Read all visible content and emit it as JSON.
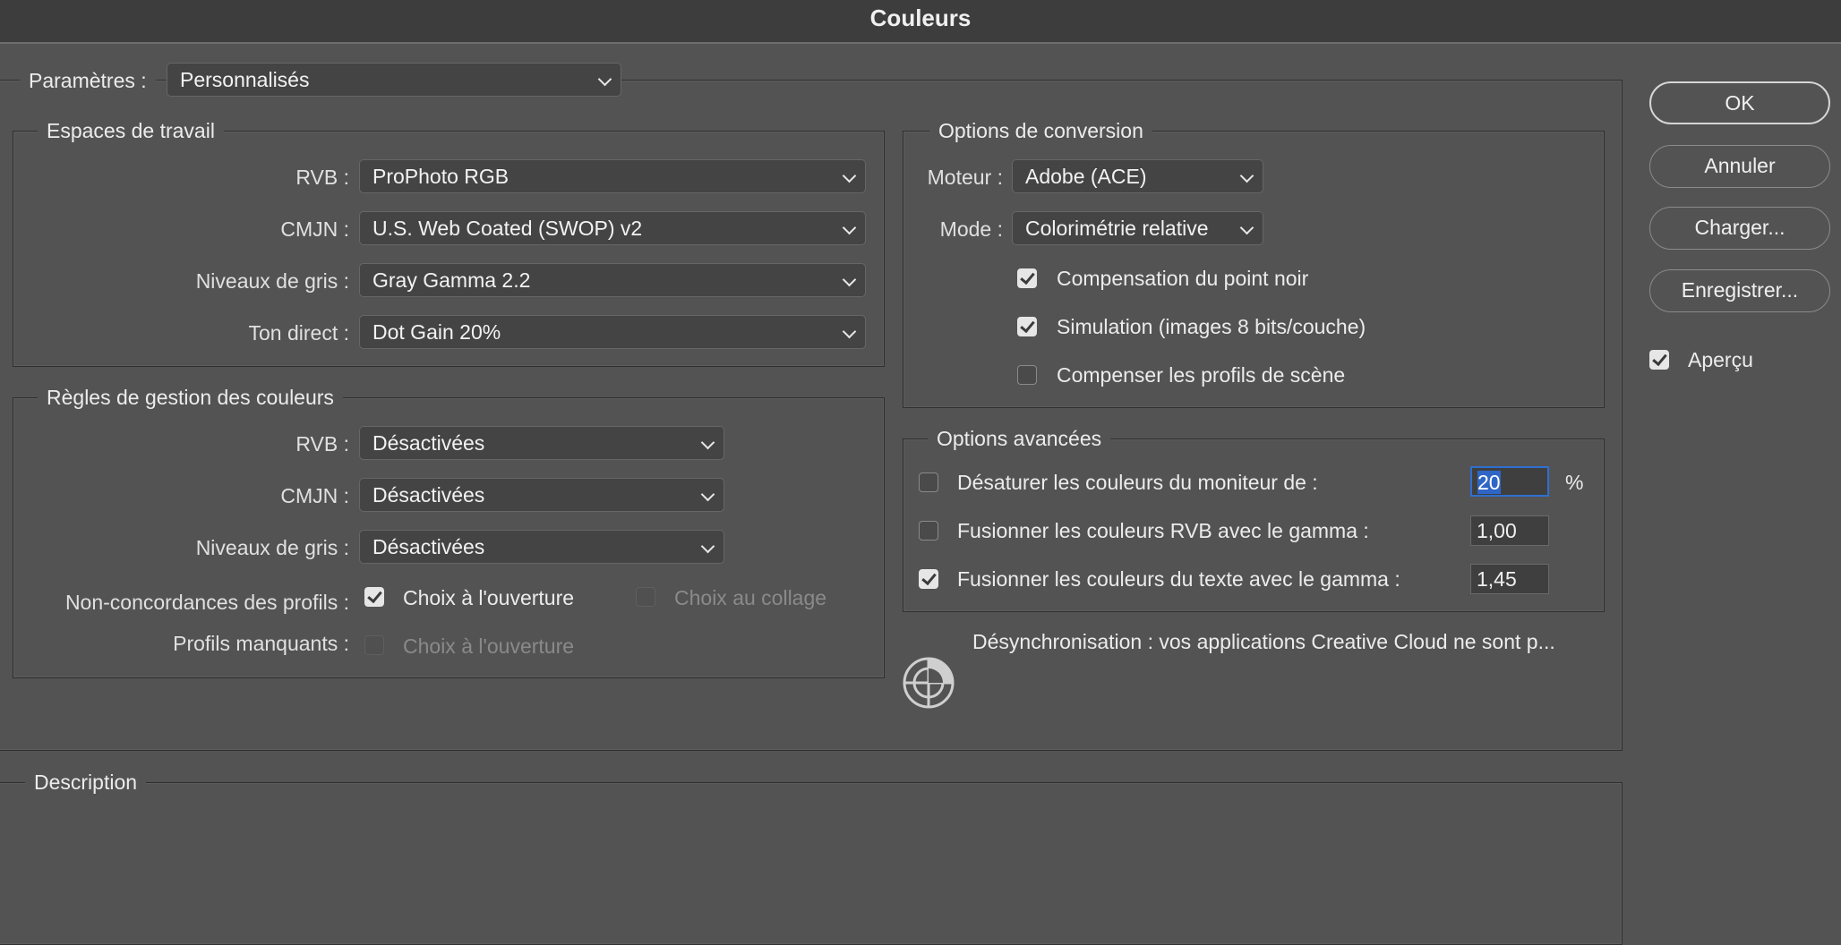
{
  "window": {
    "title": "Couleurs"
  },
  "settings": {
    "label": "Paramètres :",
    "value": "Personnalisés"
  },
  "working_spaces": {
    "title": "Espaces de travail",
    "rows": [
      {
        "label": "RVB :",
        "value": "ProPhoto RGB"
      },
      {
        "label": "CMJN :",
        "value": "U.S. Web Coated (SWOP) v2"
      },
      {
        "label": "Niveaux de gris :",
        "value": "Gray Gamma 2.2"
      },
      {
        "label": "Ton direct :",
        "value": "Dot Gain 20%"
      }
    ]
  },
  "policies": {
    "title": "Règles de gestion des couleurs",
    "rows": [
      {
        "label": "RVB :",
        "value": "Désactivées"
      },
      {
        "label": "CMJN :",
        "value": "Désactivées"
      },
      {
        "label": "Niveaux de gris :",
        "value": "Désactivées"
      }
    ],
    "mismatch_label": "Non-concordances des profils :",
    "mismatch_open": {
      "label": "Choix à l'ouverture",
      "checked": true,
      "enabled": true
    },
    "mismatch_paste": {
      "label": "Choix au collage",
      "checked": false,
      "enabled": false
    },
    "missing_label": "Profils manquants :",
    "missing_open": {
      "label": "Choix à l'ouverture",
      "checked": false,
      "enabled": false
    }
  },
  "conversion": {
    "title": "Options de conversion",
    "engine_label": "Moteur :",
    "engine_value": "Adobe (ACE)",
    "intent_label": "Mode :",
    "intent_value": "Colorimétrie relative",
    "black_point": {
      "label": "Compensation du point noir",
      "checked": true
    },
    "dither": {
      "label": "Simulation (images 8 bits/couche)",
      "checked": true
    },
    "scene_profiles": {
      "label": "Compenser les profils de scène",
      "checked": false
    }
  },
  "advanced": {
    "title": "Options avancées",
    "desaturate": {
      "label": "Désaturer les couleurs du moniteur de :",
      "checked": false,
      "value": "20",
      "unit": "%"
    },
    "blend_rgb": {
      "label": "Fusionner les couleurs RVB avec le gamma :",
      "checked": false,
      "value": "1,00"
    },
    "blend_text": {
      "label": "Fusionner les couleurs du texte avec le gamma :",
      "checked": true,
      "value": "1,45"
    }
  },
  "sync_message": "Désynchronisation : vos applications Creative Cloud ne sont p...",
  "description": {
    "title": "Description"
  },
  "buttons": {
    "ok": "OK",
    "cancel": "Annuler",
    "load": "Charger...",
    "save": "Enregistrer..."
  },
  "preview": {
    "label": "Aperçu",
    "checked": true
  },
  "colors": {
    "background": "#535353",
    "titlebar": "#3d3d3d",
    "focus": "#2e6fd1"
  }
}
